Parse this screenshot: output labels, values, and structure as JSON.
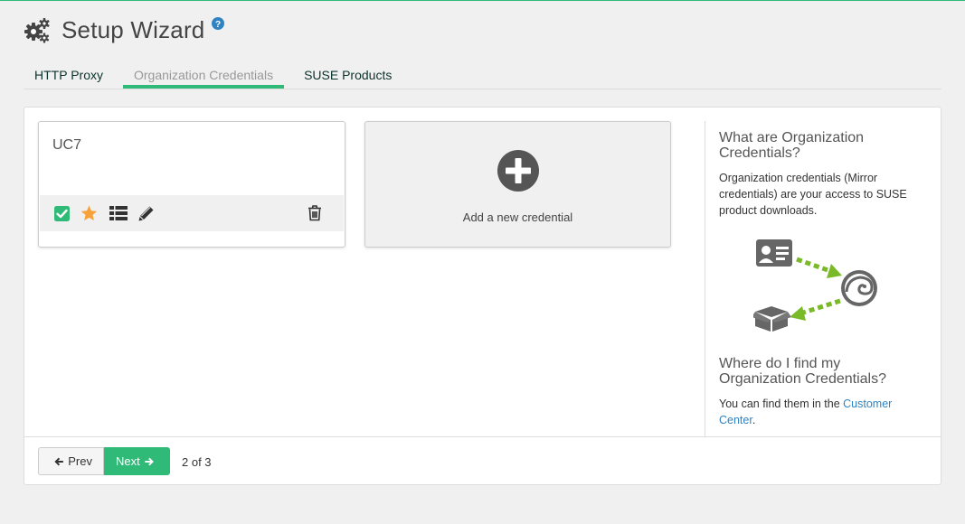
{
  "header": {
    "title": "Setup Wizard",
    "icon": "gears-icon",
    "help_icon": "help-icon"
  },
  "tabs": [
    {
      "label": "HTTP Proxy",
      "active": false
    },
    {
      "label": "Organization Credentials",
      "active": true
    },
    {
      "label": "SUSE Products",
      "active": false
    }
  ],
  "credentials": [
    {
      "name": "UC7",
      "actions": [
        "checkbox-icon",
        "star-icon",
        "list-icon",
        "edit-icon",
        "trash-icon"
      ]
    }
  ],
  "add_card": {
    "label": "Add a new credential",
    "icon": "plus-circle-icon"
  },
  "sidebar": {
    "heading1": "What are Organization Credentials?",
    "text1": "Organization credentials (Mirror credentials) are your access to SUSE product downloads.",
    "heading2": "Where do I find my Organization Credentials?",
    "text2_prefix": "You can find them in the ",
    "text2_link": "Customer Center",
    "text2_suffix": "."
  },
  "footer": {
    "prev_label": "Prev",
    "next_label": "Next",
    "page_count": "2 of 3"
  },
  "colors": {
    "accent": "#30ba78",
    "link": "#2f83c2",
    "star": "#f7a13a",
    "checkbox": "#30ba78"
  }
}
